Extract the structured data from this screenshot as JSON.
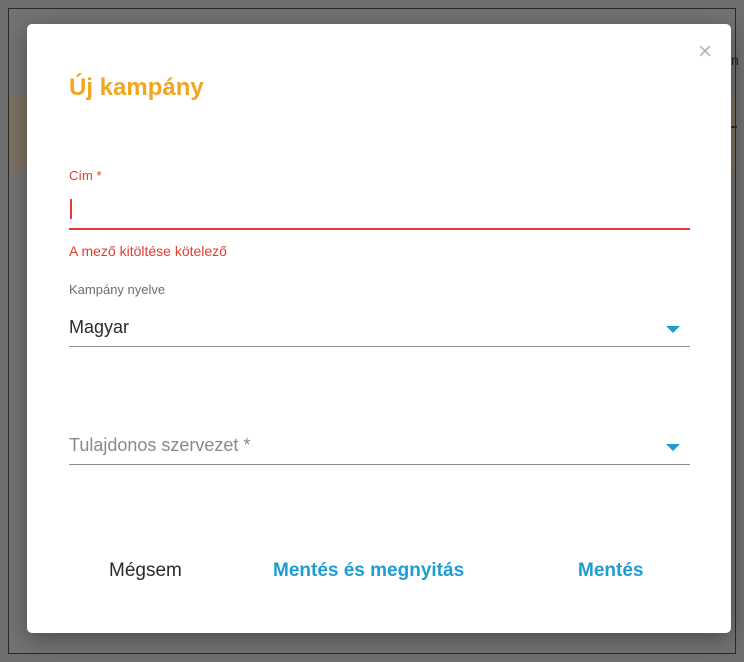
{
  "backdrop": {
    "right_edge_text": "n"
  },
  "dialog": {
    "title": "Új kampány",
    "close_symbol": "×",
    "fields": {
      "cim": {
        "label": "Cím *",
        "value": "",
        "error": "A mező kitöltése kötelező"
      },
      "language": {
        "label": "Kampány nyelve",
        "value": "Magyar"
      },
      "owner": {
        "placeholder": "Tulajdonos szervezet *",
        "value": ""
      }
    },
    "buttons": {
      "cancel": "Mégsem",
      "save_and_open": "Mentés és megnyitás",
      "save": "Mentés"
    }
  },
  "colors": {
    "title": "#f2a51e",
    "error": "#e63a32",
    "accent": "#1d9dd1"
  },
  "icons": {
    "close": "close-icon",
    "dropdown": "chevron-down-icon"
  }
}
